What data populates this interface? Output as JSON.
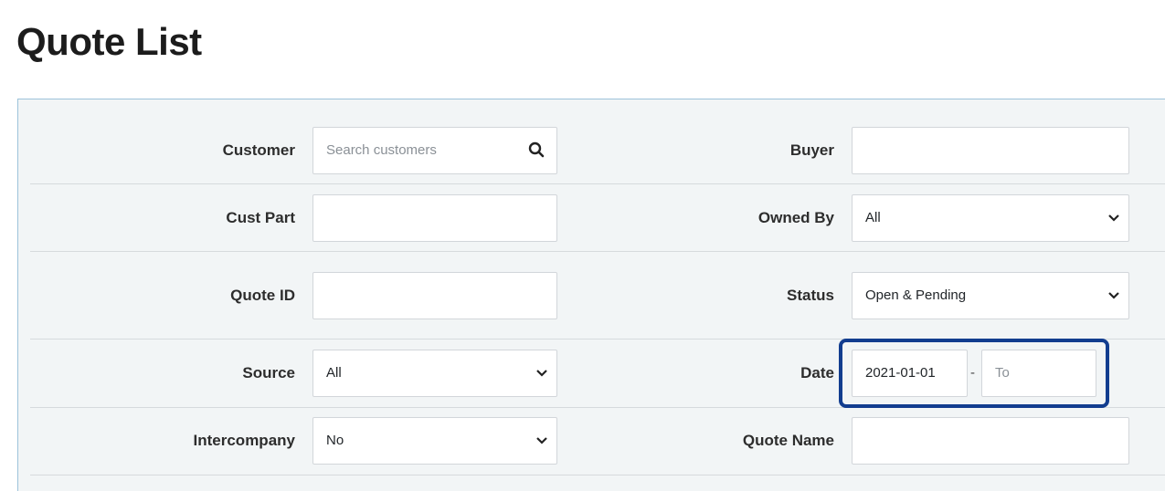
{
  "page": {
    "title": "Quote List"
  },
  "filters": {
    "customer": {
      "label": "Customer",
      "placeholder": "Search customers",
      "value": "",
      "icon": "search-icon"
    },
    "buyer": {
      "label": "Buyer",
      "value": ""
    },
    "cust_part": {
      "label": "Cust Part",
      "value": ""
    },
    "owned_by": {
      "label": "Owned By",
      "selected": "All"
    },
    "quote_id": {
      "label": "Quote ID",
      "value": ""
    },
    "status": {
      "label": "Status",
      "selected": "Open & Pending"
    },
    "source": {
      "label": "Source",
      "selected": "All"
    },
    "date": {
      "label": "Date",
      "from_value": "2021-01-01",
      "separator": "-",
      "to_placeholder": "To"
    },
    "intercompany": {
      "label": "Intercompany",
      "selected": "No"
    },
    "quote_name": {
      "label": "Quote Name",
      "value": ""
    }
  },
  "colors": {
    "highlight": "#123d8f",
    "panel_bg": "#f2f5f6",
    "panel_border": "#9cc3da"
  }
}
